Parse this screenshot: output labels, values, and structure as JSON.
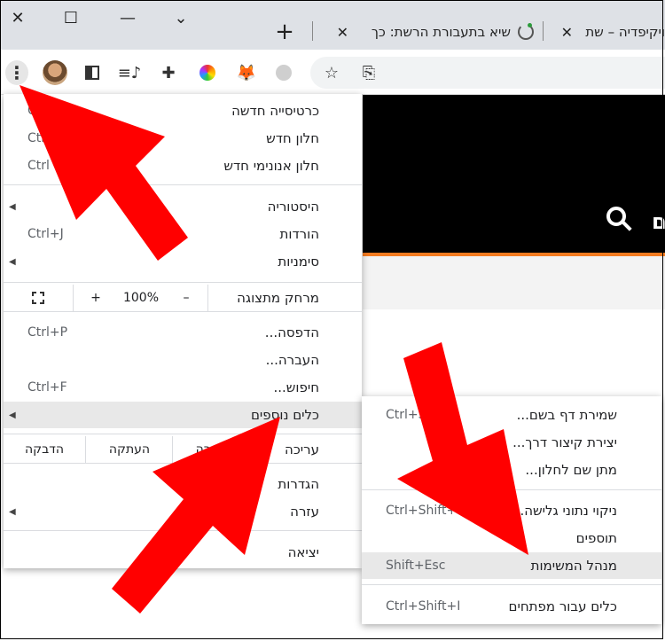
{
  "tabs": [
    {
      "title": "שיא בתעבורת הרשת: כך",
      "has_spinner": true
    },
    {
      "title": "ויקיפדיה – שת"
    }
  ],
  "window_controls": {
    "close": "✕",
    "maximize": "☐",
    "minimize": "—",
    "dropdown": "⌄"
  },
  "new_tab": "+",
  "main_menu": {
    "items": [
      {
        "label": "כרטיסייה חדשה",
        "shortcut": "Ct"
      },
      {
        "label": "חלון חדש",
        "shortcut": "Ctrl"
      },
      {
        "label": "חלון אנונימי חדש",
        "shortcut": "Ctrl"
      },
      {
        "label": "היסטוריה",
        "shortcut": ""
      },
      {
        "label": "הורדות",
        "shortcut": "Ctrl+J"
      },
      {
        "label": "סימניות",
        "shortcut": ""
      },
      {
        "label": "הדפסה...",
        "shortcut": "Ctrl+P"
      },
      {
        "label": "העברה...",
        "shortcut": ""
      },
      {
        "label": "חיפוש...",
        "shortcut": "Ctrl+F"
      },
      {
        "label": "כלים נוספים",
        "shortcut": ""
      },
      {
        "label": "הגדרות",
        "shortcut": ""
      },
      {
        "label": "עזרה",
        "shortcut": ""
      },
      {
        "label": "יציאה",
        "shortcut": ""
      }
    ],
    "zoom": {
      "label": "מרחק מתצוגה",
      "minus": "–",
      "value": "100%",
      "plus": "+"
    },
    "edit": {
      "label": "עריכה",
      "cut": "גזירה",
      "copy": "העתקה",
      "paste": "הדבקה"
    }
  },
  "sub_menu": {
    "items": [
      {
        "label": "שמירת דף בשם...",
        "shortcut": "Ctrl+S"
      },
      {
        "label": "יצירת קיצור דרך...",
        "shortcut": ""
      },
      {
        "label": "מתן שם לחלון...",
        "shortcut": ""
      },
      {
        "label": "ניקוי נתוני גלישה...",
        "shortcut": "Ctrl+Shift+Del"
      },
      {
        "label": "תוספים",
        "shortcut": ""
      },
      {
        "label": "מנהל המשימות",
        "shortcut": "Shift+Esc"
      },
      {
        "label": "כלים עבור מפתחים",
        "shortcut": "Ctrl+Shift+I"
      }
    ]
  },
  "colors": {
    "accent_orange": "#f47b20",
    "arrow_red": "#ff0000",
    "highlight": "#e8e8e8"
  }
}
